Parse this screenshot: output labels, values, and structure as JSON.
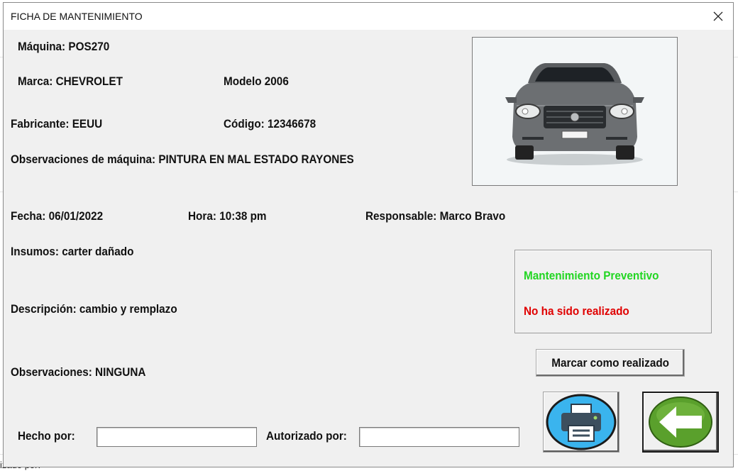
{
  "window": {
    "title": "FICHA DE MANTENIMIENTO"
  },
  "background": {
    "partial_label": "izado por:"
  },
  "machine": {
    "maquina": "Máquina: POS270",
    "marca": "Marca: CHEVROLET",
    "modelo": "Modelo 2006",
    "fabricante": "Fabricante: EEUU",
    "codigo": "Código: 12346678",
    "observaciones_maquina": "Observaciones de máquina: PINTURA EN MAL ESTADO RAYONES"
  },
  "record": {
    "fecha": "Fecha: 06/01/2022",
    "hora": "Hora: 10:38 pm",
    "responsable": "Responsable: Marco Bravo",
    "insumos": "Insumos: carter dañado",
    "descripcion": "Descripción: cambio y remplazo",
    "observaciones": "Observaciones: NINGUNA"
  },
  "status": {
    "tipo": "Mantenimiento Preventivo",
    "estado": "No ha sido realizado",
    "tipo_color": "#22d622",
    "estado_color": "#e00000"
  },
  "actions": {
    "mark_done": "Marcar como realizado",
    "print_icon": "printer-icon",
    "back_icon": "back-arrow-icon"
  },
  "signatures": {
    "hecho_por_label": "Hecho por:",
    "hecho_por_value": "",
    "autorizado_por_label": "Autorizado por:",
    "autorizado_por_value": ""
  }
}
